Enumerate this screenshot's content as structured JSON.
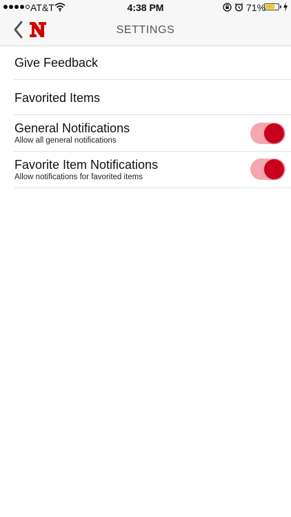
{
  "status_bar": {
    "carrier": "AT&T",
    "time": "4:38 PM",
    "battery": "71%",
    "battery_level": 0.71,
    "battery_color": "#f5c518",
    "icons": [
      "signal-dots",
      "wifi-icon",
      "orientation-lock-icon",
      "alarm-icon",
      "battery-icon",
      "charging-icon"
    ]
  },
  "nav": {
    "title": "SETTINGS",
    "back_icon": "chevron-left-icon",
    "logo_letter": "N",
    "logo_color": "#d00000"
  },
  "settings": [
    {
      "label": "Give Feedback"
    },
    {
      "label": "Favorited Items"
    },
    {
      "label": "General Notifications",
      "description": "Allow all general notifications",
      "enabled": true
    },
    {
      "label": "Favorite Item Notifications",
      "description": "Allow notifications for favorited items",
      "enabled": true
    }
  ],
  "colors": {
    "toggle_track": "#f6a6ae",
    "toggle_knob": "#c8001b"
  }
}
